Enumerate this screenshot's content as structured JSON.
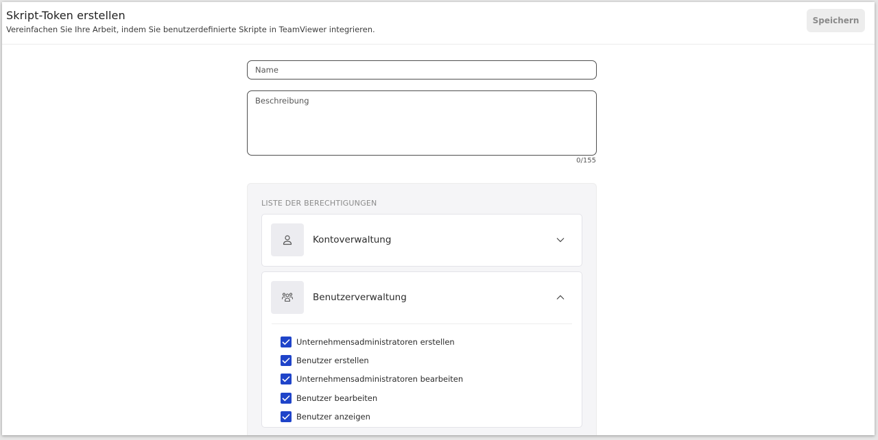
{
  "header": {
    "title": "Skript-Token erstellen",
    "subtitle": "Vereinfachen Sie Ihre Arbeit, indem Sie benutzerdefinierte Skripte in TeamViewer integrieren.",
    "save_label": "Speichern"
  },
  "form": {
    "name_placeholder": "Name",
    "name_value": "",
    "description_placeholder": "Beschreibung",
    "description_value": "",
    "char_counter": "0/155"
  },
  "permissions": {
    "heading": "LISTE DER BERECHTIGUNGEN",
    "groups": [
      {
        "label": "Kontoverwaltung",
        "icon": "user-icon",
        "expanded": false
      },
      {
        "label": "Benutzerverwaltung",
        "icon": "user-group-icon",
        "expanded": true,
        "items": [
          {
            "label": "Unternehmensadministratoren erstellen",
            "checked": true
          },
          {
            "label": "Benutzer erstellen",
            "checked": true
          },
          {
            "label": "Unternehmensadministratoren bearbeiten",
            "checked": true
          },
          {
            "label": "Benutzer bearbeiten",
            "checked": true
          },
          {
            "label": "Benutzer anzeigen",
            "checked": true
          }
        ]
      }
    ]
  },
  "colors": {
    "checkbox": "#1f44c9",
    "save_button_bg": "#ededed",
    "panel_bg": "#f5f5f7"
  }
}
